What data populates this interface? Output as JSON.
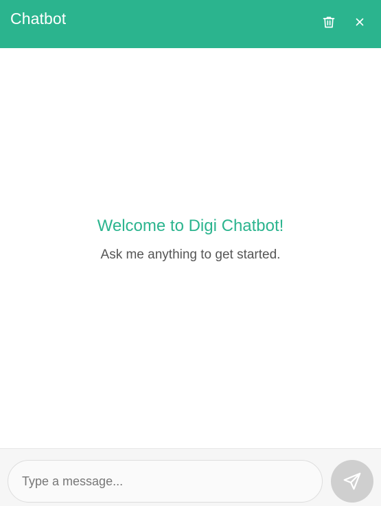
{
  "header": {
    "title": "Chatbot",
    "trash_icon": "trash-icon",
    "close_icon": "close-icon",
    "background_color": "#2bb48e"
  },
  "welcome": {
    "title": "Welcome to Digi Chatbot!",
    "subtitle": "Ask me anything to get started.",
    "accent_color": "#2bb48e"
  },
  "composer": {
    "placeholder": "Type a message...",
    "value": "",
    "send_icon": "send-icon",
    "send_disabled": true
  }
}
